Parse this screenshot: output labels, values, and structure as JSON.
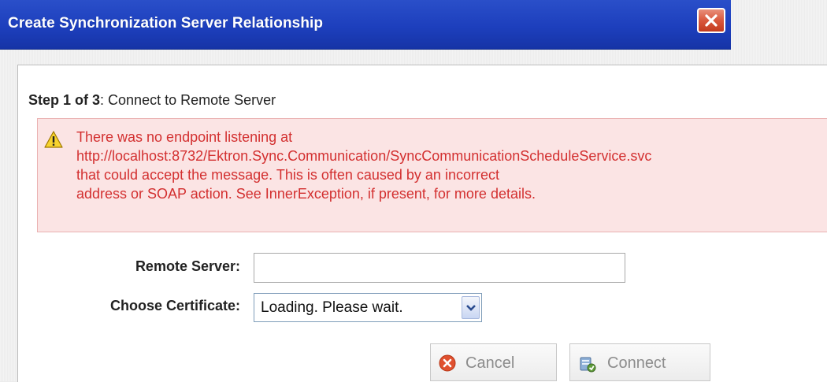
{
  "window": {
    "title": "Create Synchronization Server Relationship",
    "close_icon": "close-x-icon"
  },
  "step": {
    "prefix": "Step 1 of 3",
    "text": ": Connect to Remote Server"
  },
  "error": {
    "icon": "warning-triangle-icon",
    "lines": [
      "There was no endpoint listening at",
      "http://localhost:8732/Ektron.Sync.Communication/SyncCommunicationScheduleService.svc",
      "that could accept the message. This is often caused by an incorrect",
      "address or SOAP action. See InnerException, if present, for more details."
    ],
    "text_color": "#d33030",
    "background": "#fbe4e4"
  },
  "form": {
    "remote_server_label": "Remote Server:",
    "remote_server_value": "",
    "certificate_label": "Choose Certificate:",
    "certificate_selected": "Loading. Please wait."
  },
  "buttons": {
    "cancel_label": "Cancel",
    "cancel_icon": "cancel-circle-icon",
    "connect_label": "Connect",
    "connect_icon": "server-connect-icon"
  },
  "colors": {
    "titlebar": "#1d3fbd",
    "close_button": "#d9583d"
  }
}
